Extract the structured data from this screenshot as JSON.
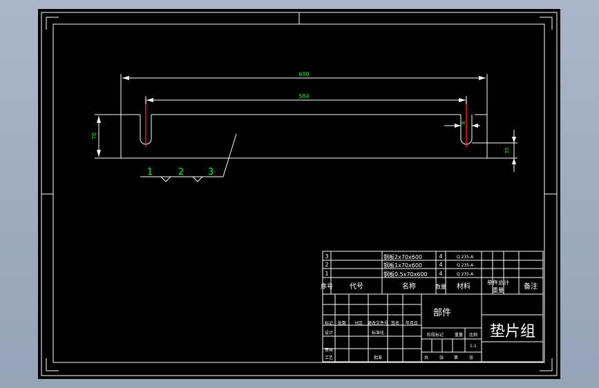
{
  "drawing": {
    "dimensions": {
      "overall_length": "600",
      "slot_pitch": "584",
      "height": "70",
      "slot_width": "8",
      "slot_depth": "35"
    },
    "balloons": [
      "1",
      "2",
      "3"
    ]
  },
  "parts_list": {
    "rows": [
      {
        "no": "3",
        "name": "钢板2x70x600",
        "qty": "4",
        "material": "Q 235-A"
      },
      {
        "no": "2",
        "name": "钢板1x70x600",
        "qty": "4",
        "material": "Q 235-A"
      },
      {
        "no": "1",
        "name": "钢板0.5x70x600",
        "qty": "4",
        "material": "Q 235-A"
      }
    ],
    "headers": {
      "no": "序号",
      "code": "代号",
      "name": "名称",
      "qty": "数量",
      "material": "材料",
      "weight_line1": "单件总计",
      "weight_line2": "重量",
      "remark": "备注"
    }
  },
  "title_block": {
    "part_label": "部件",
    "title": "垫片组",
    "sign_rows": [
      [
        "标记",
        "处数",
        "分区",
        "更改文件号",
        "签名",
        "年月日"
      ],
      [
        "设计",
        "",
        "标准化",
        "",
        "",
        ""
      ],
      [
        "审核",
        "",
        "",
        "",
        "",
        ""
      ],
      [
        "工艺",
        "",
        "批准",
        "",
        "",
        ""
      ]
    ],
    "stage_labels": [
      "阶段标记",
      "重量",
      "比例"
    ],
    "stage_values": [
      "",
      "",
      "1:1"
    ],
    "sheet_labels": [
      "共",
      "张",
      "第",
      "张"
    ]
  }
}
